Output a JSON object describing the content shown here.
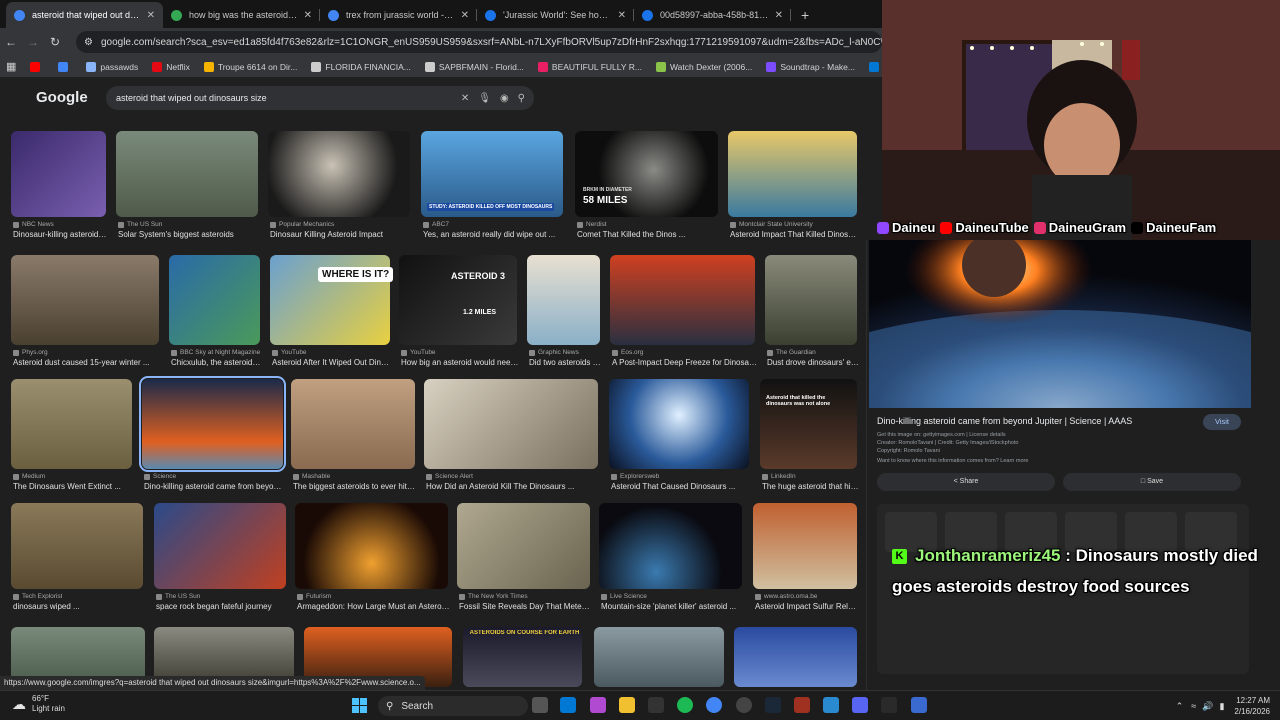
{
  "tabs": [
    {
      "title": "asteroid that wiped out dinosaurs",
      "active": true,
      "color": "#4285f4"
    },
    {
      "title": "how big was the asteroid that k",
      "active": false,
      "color": "#34a853"
    },
    {
      "title": "trex from jurassic world - Goog",
      "active": false,
      "color": "#4285f4"
    },
    {
      "title": "'Jurassic World': See how T. rex",
      "active": false,
      "color": "#1a73e8"
    },
    {
      "title": "00d58997-abba-458b-8154-9c",
      "active": false,
      "color": "#1a73e8"
    }
  ],
  "toolbar": {
    "url": "google.com/search?sca_esv=ed1a85fd4f763e82&rlz=1C1ONGR_enUS959US959&sxsrf=ANbL-n7LXyFfbORVl5up7zDfrHnF2sxhqg:1771219591097&udm=2&fbs=ADc_l-aN0CWEZBOHjofHoal"
  },
  "bookmarks": [
    {
      "label": "",
      "color": "#ff0000"
    },
    {
      "label": "",
      "color": "#4285f4"
    },
    {
      "label": "passawds",
      "color": "#8ab4f8"
    },
    {
      "label": "Netflix",
      "color": "#e50914"
    },
    {
      "label": "Troupe 6614 on Dir...",
      "color": "#f4b400"
    },
    {
      "label": "FLORIDA FINANCIA...",
      "color": "#cccccc"
    },
    {
      "label": "SAPBFMAIN - Florid...",
      "color": "#cccccc"
    },
    {
      "label": "BEAUTIFUL FULLY R...",
      "color": "#e91e63"
    },
    {
      "label": "Watch Dexter (2006...",
      "color": "#8bc34a"
    },
    {
      "label": "Soundtrap - Make...",
      "color": "#7c4dff"
    },
    {
      "label": "Mail - · Outlook",
      "color": "#0078d4"
    }
  ],
  "google": {
    "logo": "Google",
    "query": "asteroid that wiped out dinosaurs size"
  },
  "results": [
    {
      "source": "NBC News",
      "caption": "Dinosaur-killing asteroid sp...",
      "bg": "linear-gradient(135deg,#3a2a6b,#7a5fb0)"
    },
    {
      "source": "The US Sun",
      "caption": "Solar System's biggest asteroids",
      "bg": "linear-gradient(180deg,#7a8a7a,#4f5a4a)"
    },
    {
      "source": "Popular Mechanics",
      "caption": "Dinosaur Killing Asteroid Impact",
      "bg": "radial-gradient(circle at 45% 40%,#c9c2b5,#1a1a1a 70%)"
    },
    {
      "source": "ABC7",
      "caption": "Yes, an asteroid really did wipe out ...",
      "bg": "linear-gradient(180deg,#5aa6e0,#2a5a8a)"
    },
    {
      "source": "Nerdist",
      "caption": "Comet That Killed the Dinos ...",
      "bg": "radial-gradient(circle at 55% 45%,#8a8a86,#0d0d0d 60%)"
    },
    {
      "source": "Montclair State University",
      "caption": "Asteroid Impact That Killed Dinosaur...",
      "bg": "linear-gradient(180deg,#e8c868,#3a7aa0)"
    },
    {
      "source": "Phys.org",
      "caption": "Asteroid dust caused 15-year winter ...",
      "bg": "linear-gradient(180deg,#8a7a6a,#4a4030)"
    },
    {
      "source": "BBC Sky at Night Magazine",
      "caption": "Chicxulub, the asteroid th...",
      "bg": "linear-gradient(135deg,#2a6aa8,#4a9a5a)"
    },
    {
      "source": "YouTube",
      "caption": "Asteroid After It Wiped Out Dinos...",
      "bg": "linear-gradient(135deg,#6aa0d0,#e8d040)"
    },
    {
      "source": "YouTube",
      "caption": "How big an asteroid would need t...",
      "bg": "linear-gradient(135deg,#111,#3a3a3a)"
    },
    {
      "source": "Graphic News",
      "caption": "Did two asteroids ki...",
      "bg": "linear-gradient(180deg,#e8e0d0,#8ab0c8)"
    },
    {
      "source": "Eos.org",
      "caption": "A Post-Impact Deep Freeze for Dinosaurs ...",
      "bg": "linear-gradient(180deg,#d04020,#2a3040)"
    },
    {
      "source": "The Guardian",
      "caption": "Dust drove dinosaurs' exti...",
      "bg": "linear-gradient(180deg,#8a8a7a,#3a4030)"
    },
    {
      "source": "Medium",
      "caption": "The Dinosaurs Went Extinct ...",
      "bg": "linear-gradient(180deg,#9a9070,#6a6040)"
    },
    {
      "source": "Science",
      "caption": "Dino-killing asteroid came from beyond ...",
      "bg": "linear-gradient(180deg,#1a2a4a,#e06020 70%,#5a8ab0)"
    },
    {
      "source": "Mashable",
      "caption": "The biggest asteroids to ever hit Ea...",
      "bg": "linear-gradient(180deg,#c0a080,#8a6a50)"
    },
    {
      "source": "Science Alert",
      "caption": "How Did an Asteroid Kill The Dinosaurs ...",
      "bg": "linear-gradient(135deg,#d8d0c0,#7a7060)"
    },
    {
      "source": "Explorersweb",
      "caption": "Asteroid That Caused Dinosaurs ...",
      "bg": "radial-gradient(circle at 50% 40%,#e0f0ff,#2a5a9a 55%,#0a1020)"
    },
    {
      "source": "LinkedIn",
      "caption": "The huge asteroid that hit E...",
      "bg": "linear-gradient(180deg,#111,#5a3a2a)"
    },
    {
      "source": "Tech Explorist",
      "caption": "dinosaurs wiped ...",
      "bg": "linear-gradient(180deg,#8a7a5a,#5a4a30)"
    },
    {
      "source": "The US Sun",
      "caption": "space rock began fateful journey",
      "bg": "linear-gradient(135deg,#2a4a8a,#c04020)"
    },
    {
      "source": "Futurism",
      "caption": "Armageddon: How Large Must an Asteroid ...",
      "bg": "radial-gradient(circle at 50% 70%,#f0a030,#1a0a05 70%)"
    },
    {
      "source": "The New York Times",
      "caption": "Fossil Site Reveals Day That Meteor Hi...",
      "bg": "linear-gradient(135deg,#b0a890,#6a6450)"
    },
    {
      "source": "Live Science",
      "caption": "Mountain-size 'planet killer' asteroid ...",
      "bg": "radial-gradient(circle at 40% 80%,#3a7ab0,#0a0a10 60%)"
    },
    {
      "source": "www.astro.oma.be",
      "caption": "Asteroid Impact Sulfur Relea...",
      "bg": "linear-gradient(180deg,#c06030,#d0c0a0)"
    },
    {
      "source": "",
      "caption": "",
      "bg": "linear-gradient(180deg,#7a8a7a,#4a5a4a)"
    },
    {
      "source": "",
      "caption": "",
      "bg": "linear-gradient(180deg,#8a8a80,#3a3a30)"
    },
    {
      "source": "",
      "caption": "",
      "bg": "linear-gradient(180deg,#e06020,#3a2010)"
    },
    {
      "source": "",
      "caption": "ASTEROIDS ON COURSE FOR EARTH",
      "bg": "linear-gradient(180deg,#1a1a2a,#4a4a5a)"
    },
    {
      "source": "",
      "caption": "",
      "bg": "linear-gradient(180deg,#8a9aa0,#4a5a60)"
    },
    {
      "source": "",
      "caption": "",
      "bg": "linear-gradient(180deg,#2a4aa0,#6a8ad0)"
    }
  ],
  "thumb_text": {
    "t1": "BRKM IN DIAMETER",
    "t2": "58 MILES",
    "t3": "STUDY: ASTEROID KILLED OFF MOST DINOSAURS",
    "t4": "WHERE IS IT?",
    "t5": "ASTEROID 3",
    "t6": "1.2 MILES",
    "t7": "Asteroid that killed the dinosaurs was not alone"
  },
  "status_url": "https://www.google.com/imgres?q=asteroid that wiped out dinosaurs size&imgurl=https%3A%2F%2Fwww.science.o...",
  "panel": {
    "title": "Dino-killing asteroid came from beyond Jupiter | Science | AAAS",
    "visit": "Visit",
    "meta1": "Get this image on: gettyimages.com | License details",
    "meta2": "Creator: RomoloTavani | Credit: Getty Images/iStockphoto",
    "meta3": "Copyright: Romolo Tavani",
    "meta4": "Want to know where this information comes from? Learn more",
    "share": "Share",
    "save": "Save"
  },
  "overlay": {
    "social": [
      {
        "handle": "Daineu",
        "color": "#9146ff"
      },
      {
        "handle": "DaineuTube",
        "color": "#ff0000"
      },
      {
        "handle": "DaineuGram",
        "color": "#e1306c"
      },
      {
        "handle": "DaineuFam",
        "color": "#000000"
      }
    ],
    "chat_user": "Jonthanrameriz45",
    "chat_message": " : Dinosaurs mostly died goes asteroids destroy food sources"
  },
  "taskbar": {
    "temp": "66°F",
    "weather": "Light rain",
    "search": "Search",
    "time": "12:27 AM",
    "date": "2/16/2026"
  }
}
